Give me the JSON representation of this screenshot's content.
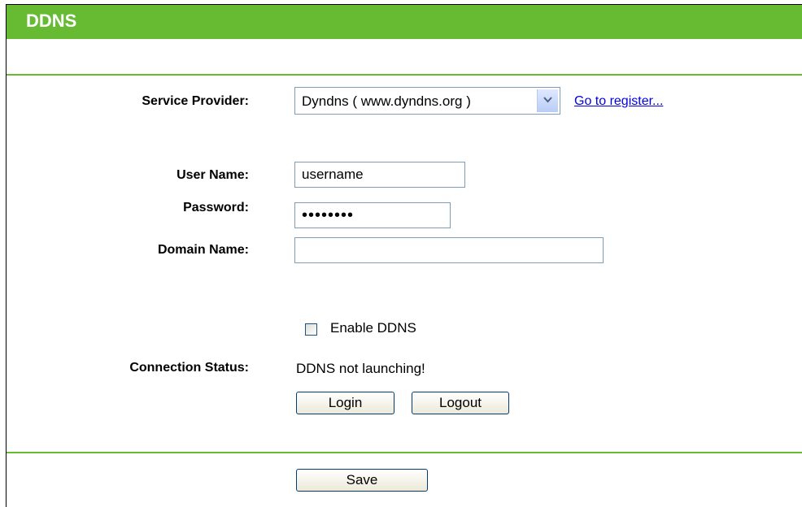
{
  "header": {
    "title": "DDNS"
  },
  "service_provider": {
    "label": "Service Provider:",
    "selected": "Dyndns ( www.dyndns.org )",
    "register_link": "Go to register..."
  },
  "user_name": {
    "label": "User Name:",
    "value": "username"
  },
  "password": {
    "label": "Password:",
    "value": "••••••••"
  },
  "domain_name": {
    "label": "Domain Name:",
    "value": ""
  },
  "enable_ddns": {
    "label": "Enable DDNS",
    "checked": false
  },
  "connection_status": {
    "label": "Connection Status:",
    "value": "DDNS not launching!"
  },
  "buttons": {
    "login": "Login",
    "logout": "Logout",
    "save": "Save"
  },
  "colors": {
    "accent": "#66bb33",
    "link": "#0000ee"
  }
}
